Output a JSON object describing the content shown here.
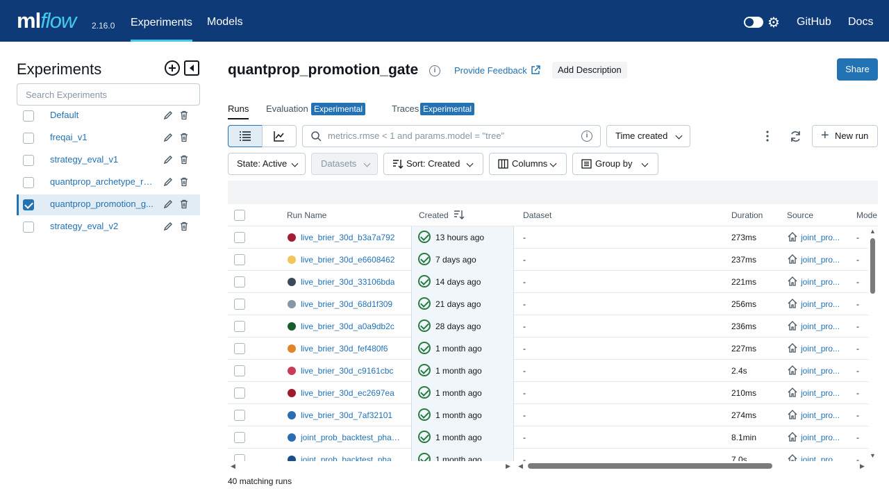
{
  "header": {
    "logo_ml": "ml",
    "logo_flow": "flow",
    "version": "2.16.0",
    "nav": [
      "Experiments",
      "Models"
    ],
    "right_links": [
      "GitHub",
      "Docs"
    ],
    "accent_color": "#43c9ed",
    "bg_color": "#0e3b78"
  },
  "sidebar": {
    "title": "Experiments",
    "search_placeholder": "Search Experiments",
    "experiments": [
      {
        "name": "Default",
        "checked": false
      },
      {
        "name": "freqai_v1",
        "checked": false
      },
      {
        "name": "strategy_eval_v1",
        "checked": false
      },
      {
        "name": "quantprop_archetype_runs",
        "checked": false
      },
      {
        "name": "quantprop_promotion_g...",
        "checked": true
      },
      {
        "name": "strategy_eval_v2",
        "checked": false
      }
    ]
  },
  "main": {
    "title": "quantprop_promotion_gate",
    "feedback": "Provide Feedback",
    "add_description": "Add Description",
    "share": "Share",
    "tabs": [
      {
        "label": "Runs",
        "badge": ""
      },
      {
        "label": "Evaluation",
        "badge": "Experimental"
      },
      {
        "label": "Traces",
        "badge": "Experimental"
      }
    ],
    "search_placeholder": "metrics.rmse < 1 and params.model = \"tree\"",
    "sort_select": "Time created",
    "new_run": "New run",
    "filters": {
      "state": "State: Active",
      "datasets": "Datasets",
      "sort": "Sort: Created",
      "columns": "Columns",
      "group_by": "Group by"
    }
  },
  "table": {
    "columns": [
      "Run Name",
      "Created",
      "Dataset",
      "Duration",
      "Source",
      "Mode"
    ],
    "rows": [
      {
        "name": "live_brier_30d_b3a7a792",
        "color": "#a31e33",
        "created": "13 hours ago",
        "dataset": "-",
        "duration": "273ms",
        "source": "joint_pro...",
        "model": "-"
      },
      {
        "name": "live_brier_30d_e6608462",
        "color": "#f2c45e",
        "created": "7 days ago",
        "dataset": "-",
        "duration": "237ms",
        "source": "joint_pro...",
        "model": "-"
      },
      {
        "name": "live_brier_30d_33106bda",
        "color": "#3a4a5c",
        "created": "14 days ago",
        "dataset": "-",
        "duration": "221ms",
        "source": "joint_pro...",
        "model": "-"
      },
      {
        "name": "live_brier_30d_68d1f309",
        "color": "#8597a8",
        "created": "21 days ago",
        "dataset": "-",
        "duration": "256ms",
        "source": "joint_pro...",
        "model": "-"
      },
      {
        "name": "live_brier_30d_a0a9db2c",
        "color": "#175e2c",
        "created": "28 days ago",
        "dataset": "-",
        "duration": "236ms",
        "source": "joint_pro...",
        "model": "-"
      },
      {
        "name": "live_brier_30d_fef480f6",
        "color": "#e08628",
        "created": "1 month ago",
        "dataset": "-",
        "duration": "227ms",
        "source": "joint_pro...",
        "model": "-"
      },
      {
        "name": "live_brier_30d_c9161cbc",
        "color": "#cc3a55",
        "created": "1 month ago",
        "dataset": "-",
        "duration": "2.4s",
        "source": "joint_pro...",
        "model": "-"
      },
      {
        "name": "live_brier_30d_ec2697ea",
        "color": "#9e1a2d",
        "created": "1 month ago",
        "dataset": "-",
        "duration": "210ms",
        "source": "joint_pro...",
        "model": "-"
      },
      {
        "name": "live_brier_30d_7af32101",
        "color": "#2a6db3",
        "created": "1 month ago",
        "dataset": "-",
        "duration": "274ms",
        "source": "joint_pro...",
        "model": "-"
      },
      {
        "name": "joint_prob_backtest_phas...",
        "color": "#2a6db3",
        "created": "1 month ago",
        "dataset": "-",
        "duration": "8.1min",
        "source": "joint_pro...",
        "model": "-"
      },
      {
        "name": "joint_prob_backtest_phas...",
        "color": "#1b4f8a",
        "created": "1 month ago",
        "dataset": "-",
        "duration": "7.0s",
        "source": "joint_pro...",
        "model": "-"
      }
    ],
    "matching_count": "40",
    "matching_label": "matching runs"
  }
}
